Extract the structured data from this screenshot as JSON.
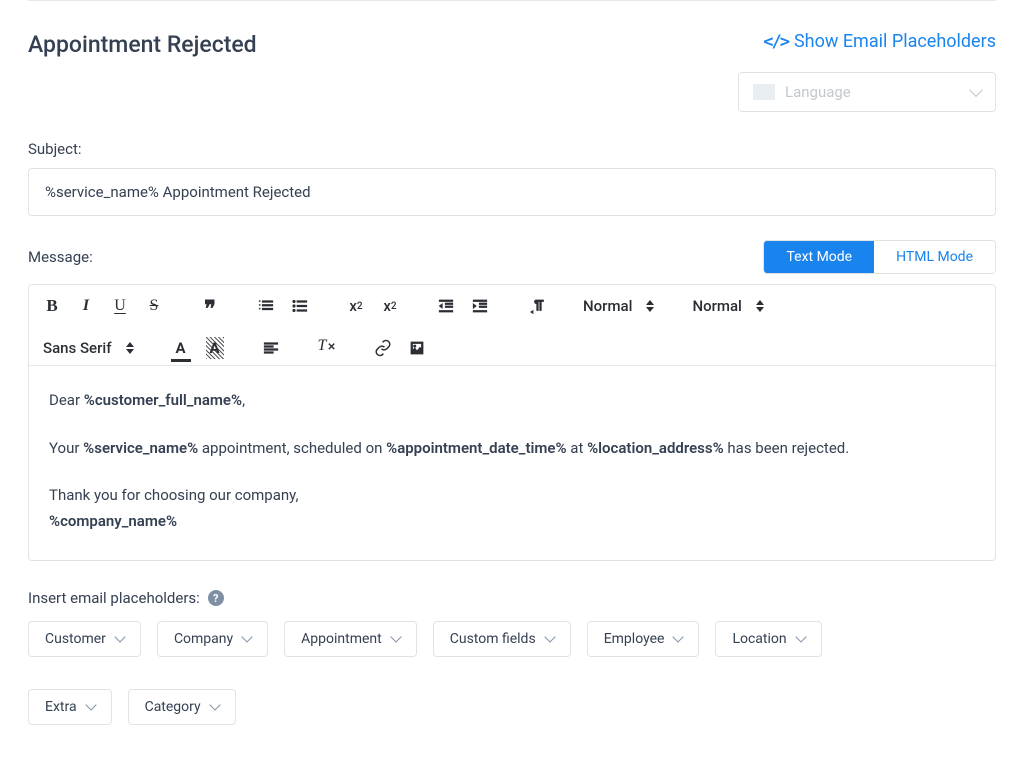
{
  "header": {
    "title": "Appointment Rejected",
    "show_placeholders_label": "Show Email Placeholders",
    "language_placeholder": "Language"
  },
  "subject": {
    "label": "Subject:",
    "value": "%service_name% Appointment Rejected"
  },
  "message": {
    "label": "Message:",
    "modes": {
      "text": "Text Mode",
      "html": "HTML Mode"
    },
    "toolbar": {
      "heading_picker": "Normal",
      "size_picker": "Normal",
      "font_picker": "Sans Serif"
    },
    "body": {
      "greeting_prefix": "Dear ",
      "greeting_name": "%customer_full_name%",
      "greeting_suffix": ",",
      "p1_a": "Your ",
      "p1_service": "%service_name%",
      "p1_b": " appointment, scheduled on ",
      "p1_datetime": "%appointment_date_time%",
      "p1_c": " at ",
      "p1_location": "%location_address%",
      "p1_d": " has been rejected.",
      "p2": "Thank you for choosing our company,",
      "company": "%company_name%"
    }
  },
  "placeholders": {
    "label": "Insert email placeholders:",
    "chips": [
      "Customer",
      "Company",
      "Appointment",
      "Custom fields",
      "Employee",
      "Location",
      "Extra",
      "Category"
    ]
  }
}
